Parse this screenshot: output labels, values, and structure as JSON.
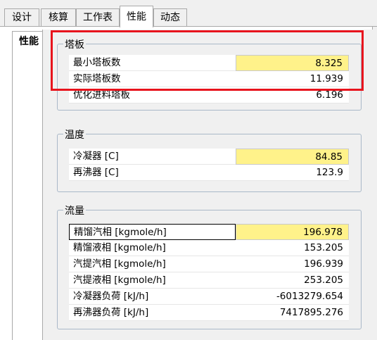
{
  "tabs": [
    "设计",
    "核算",
    "工作表",
    "性能",
    "动态"
  ],
  "active_tab": "性能",
  "side_tab": "性能",
  "groups": {
    "trays": {
      "title": "塔板",
      "rows": [
        {
          "label": "最小塔板数",
          "value": "8.325"
        },
        {
          "label": "实际塔板数",
          "value": "11.939"
        },
        {
          "label": "优化进料塔板",
          "value": "6.196"
        }
      ]
    },
    "temperature": {
      "title": "温度",
      "rows": [
        {
          "label": "冷凝器 [C]",
          "value": "84.85"
        },
        {
          "label": "再沸器 [C]",
          "value": "123.9"
        }
      ]
    },
    "flow": {
      "title": "流量",
      "rows": [
        {
          "label": "精馏汽相 [kgmole/h]",
          "value": "196.978"
        },
        {
          "label": "精馏液相 [kgmole/h]",
          "value": "153.205"
        },
        {
          "label": "汽提汽相 [kgmole/h]",
          "value": "196.939"
        },
        {
          "label": "汽提液相 [kgmole/h]",
          "value": "253.205"
        },
        {
          "label": "冷凝器负荷 [kJ/h]",
          "value": "-6013279.654"
        },
        {
          "label": "再沸器负荷 [kJ/h]",
          "value": "7417895.276"
        }
      ]
    }
  },
  "colors": {
    "highlight": "#fff28a",
    "annotation_box": "#e8141d"
  }
}
